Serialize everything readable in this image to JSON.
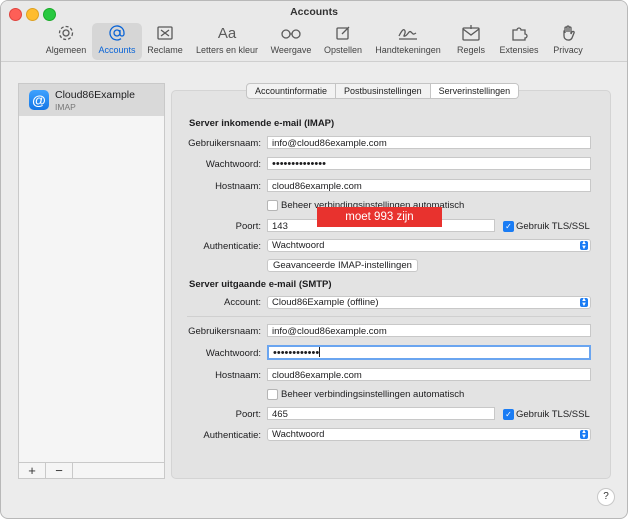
{
  "window": {
    "title": "Accounts"
  },
  "toolbar": {
    "items": [
      {
        "label": "Algemeen",
        "icon": "gear-icon"
      },
      {
        "label": "Accounts",
        "icon": "at-sign-icon",
        "selected": true
      },
      {
        "label": "Reclame",
        "icon": "junk-mail-icon"
      },
      {
        "label": "Letters en kleur",
        "icon": "fonts-icon"
      },
      {
        "label": "Weergave",
        "icon": "glasses-icon"
      },
      {
        "label": "Opstellen",
        "icon": "compose-icon"
      },
      {
        "label": "Handtekeningen",
        "icon": "signature-icon"
      },
      {
        "label": "Regels",
        "icon": "rules-icon"
      },
      {
        "label": "Extensies",
        "icon": "puzzle-icon"
      },
      {
        "label": "Privacy",
        "icon": "hand-icon"
      }
    ]
  },
  "sidebar": {
    "account": {
      "name": "Cloud86Example",
      "type": "IMAP"
    },
    "add_label": "+",
    "remove_label": "−"
  },
  "tabs": [
    {
      "label": "Accountinformatie"
    },
    {
      "label": "Postbusinstellingen"
    },
    {
      "label": "Serverinstellingen",
      "active": true
    }
  ],
  "incoming": {
    "section_title": "Server inkomende e-mail (IMAP)",
    "username_label": "Gebruikersnaam:",
    "username": "info@cloud86example.com",
    "password_label": "Wachtwoord:",
    "password_mask": "••••••••••••••",
    "hostname_label": "Hostnaam:",
    "hostname": "cloud86example.com",
    "auto_manage_label": "Beheer verbindingsinstellingen automatisch",
    "auto_manage_checked": false,
    "port_label": "Poort:",
    "port": "143",
    "tls_label": "Gebruik TLS/SSL",
    "tls_checked": true,
    "auth_label": "Authenticatie:",
    "auth_value": "Wachtwoord",
    "advanced_button": "Geavanceerde IMAP-instellingen"
  },
  "annotation": {
    "text": "moet 993 zijn",
    "color": "#e8322e"
  },
  "outgoing": {
    "section_title": "Server uitgaande e-mail (SMTP)",
    "account_label": "Account:",
    "account_value": "Cloud86Example (offline)",
    "username_label": "Gebruikersnaam:",
    "username": "info@cloud86example.com",
    "password_label": "Wachtwoord:",
    "password_mask": "••••••••••••",
    "hostname_label": "Hostnaam:",
    "hostname": "cloud86example.com",
    "auto_manage_label": "Beheer verbindingsinstellingen automatisch",
    "auto_manage_checked": false,
    "port_label": "Poort:",
    "port": "465",
    "tls_label": "Gebruik TLS/SSL",
    "tls_checked": true,
    "auth_label": "Authenticatie:",
    "auth_value": "Wachtwoord"
  },
  "help_label": "?",
  "colors": {
    "accent": "#1a7cf4",
    "annotation": "#e8322e"
  }
}
